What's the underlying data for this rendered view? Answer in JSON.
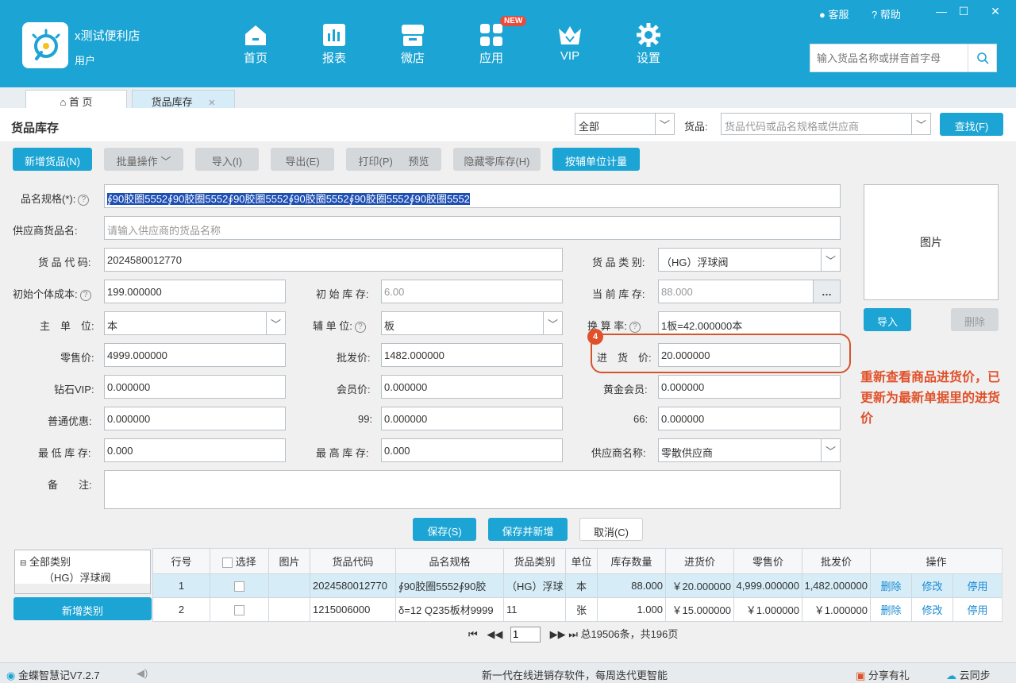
{
  "app": {
    "shop_name": "x测试便利店",
    "user_label": "用户",
    "nav": [
      "首页",
      "报表",
      "微店",
      "应用",
      "VIP",
      "设置"
    ],
    "new_badge": "NEW",
    "customer_service": "客服",
    "help": "帮助",
    "search_placeholder": "输入货品名称或拼音首字母",
    "accent_color": "#1ba4d4"
  },
  "tabs": [
    {
      "label": "首 页",
      "icon": "home-icon"
    },
    {
      "label": "货品库存",
      "icon": "close-icon"
    }
  ],
  "page": {
    "title": "货品库存",
    "filter_value": "全部",
    "goods_label": "货品:",
    "goods_placeholder": "货品代码或品名规格或供应商",
    "find_btn": "查找(F)"
  },
  "toolbar": {
    "add": "新增货品(N)",
    "batch": "批量操作",
    "import": "导入(I)",
    "export": "导出(E)",
    "print": "打印(P)",
    "preview": "预览",
    "hide_zero": "隐藏零库存(H)",
    "aux_unit": "按辅单位计量"
  },
  "form": {
    "name_label": "品名规格(*):",
    "name_value": "∮90胶圈5552∮90胶圈5552∮90胶圈5552∮90胶圈5552∮90胶圈5552∮90胶圈5552",
    "supplier_goods_label": "供应商货品名:",
    "supplier_goods_placeholder": "请输入供应商的货品名称",
    "code_label": "货 品 代 码:",
    "code_value": "2024580012770",
    "category_label": "货 品 类 别:",
    "category_value": "（HG）浮球阀",
    "init_cost_label": "初始个体成本:",
    "init_cost_value": "199.000000",
    "init_stock_label": "初 始 库 存:",
    "init_stock_value": "6.00",
    "cur_stock_label": "当 前 库 存:",
    "cur_stock_value": "88.000",
    "main_unit_label": "主　单　位:",
    "main_unit_value": "本",
    "aux_unit_label": "辅 单 位:",
    "aux_unit_value": "板",
    "ratio_label": "换 算 率:",
    "ratio_value": "1板=42.000000本",
    "retail_label": "零售价:",
    "retail_value": "4999.000000",
    "wholesale_label": "批发价:",
    "wholesale_value": "1482.000000",
    "purchase_label": "进　货　价:",
    "purchase_value": "20.000000",
    "diamond_label": "钻石VIP:",
    "diamond_value": "0.000000",
    "member_label": "会员价:",
    "member_value": "0.000000",
    "gold_label": "黄金会员:",
    "gold_value": "0.000000",
    "normal_label": "普通优惠:",
    "normal_value": "0.000000",
    "p99_label": "99:",
    "p99_value": "0.000000",
    "p66_label": "66:",
    "p66_value": "0.000000",
    "min_stock_label": "最 低 库 存:",
    "min_stock_value": "0.000",
    "max_stock_label": "最 高 库 存:",
    "max_stock_value": "0.000",
    "supplier_label": "供应商名称:",
    "supplier_value": "零散供应商",
    "remark_label": "备　　注:",
    "image_label": "图片",
    "img_import": "导入",
    "img_delete": "删除",
    "save": "保存(S)",
    "save_new": "保存并新增",
    "cancel": "取消(C)"
  },
  "annotation": {
    "step": "4",
    "text": "重新查看商品进货价，已更新为最新单据里的进货价"
  },
  "tree": {
    "root": "全部类别",
    "child": "（HG）浮球阀",
    "add_category": "新增类别"
  },
  "table": {
    "headers": [
      "行号",
      "选择",
      "图片",
      "货品代码",
      "品名规格",
      "货品类别",
      "单位",
      "库存数量",
      "进货价",
      "零售价",
      "批发价",
      "操作"
    ],
    "rows": [
      {
        "no": "1",
        "code": "2024580012770",
        "name": "∮90胶圈5552∮90胶",
        "category": "（HG）浮球",
        "unit": "本",
        "qty": "88.000",
        "purchase": "￥20.000000",
        "retail": "4,999.000000",
        "wholesale": "1,482.000000"
      },
      {
        "no": "2",
        "code": "1215006000",
        "name": "δ=12 Q235板材9999",
        "category": "11",
        "unit": "张",
        "qty": "1.000",
        "purchase": "￥15.000000",
        "retail": "￥1.000000",
        "wholesale": "￥1.000000"
      }
    ],
    "actions": [
      "删除",
      "修改",
      "停用"
    ]
  },
  "pager": {
    "page": "1",
    "summary": "总19506条，共196页"
  },
  "status": {
    "version": "金蝶智慧记V7.2.7",
    "slogan": "新一代在线进销存软件，每周迭代更智能",
    "share": "分享有礼",
    "sync": "云同步"
  }
}
